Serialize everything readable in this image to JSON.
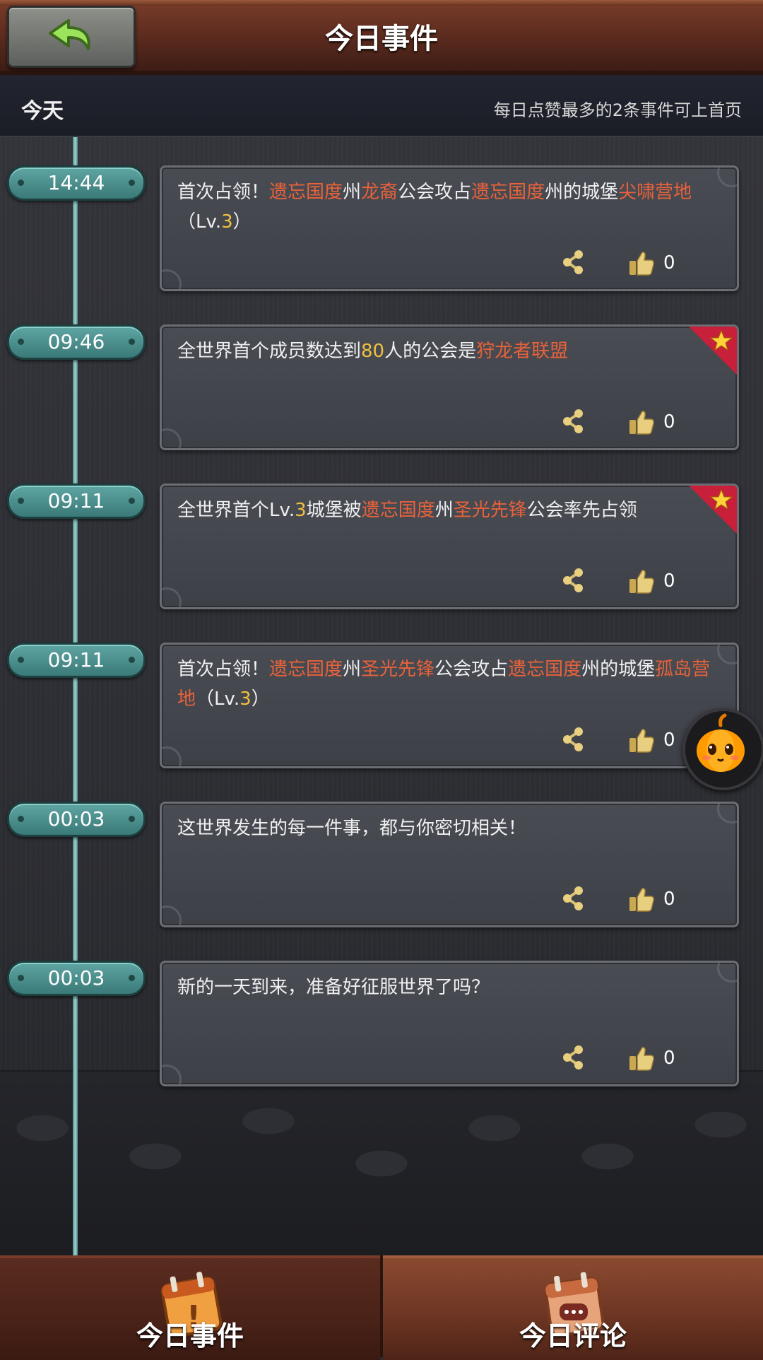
{
  "header": {
    "title": "今日事件"
  },
  "subheader": {
    "day": "今天",
    "hint": "每日点赞最多的2条事件可上首页"
  },
  "events": [
    {
      "time": "14:44",
      "likes": "0",
      "featured": false,
      "segments": [
        {
          "t": "首次占领！"
        },
        {
          "t": "遗忘国度",
          "hl": true
        },
        {
          "t": "州"
        },
        {
          "t": "龙裔",
          "hl": true
        },
        {
          "t": "公会攻占"
        },
        {
          "t": "遗忘国度",
          "hl": true
        },
        {
          "t": "州的城堡"
        },
        {
          "t": "尖啸营地",
          "hl": true
        },
        {
          "t": "（Lv."
        },
        {
          "t": "3",
          "num": true
        },
        {
          "t": "）"
        }
      ]
    },
    {
      "time": "09:46",
      "likes": "0",
      "featured": true,
      "segments": [
        {
          "t": "全世界首个成员数达到"
        },
        {
          "t": "80",
          "num": true
        },
        {
          "t": "人的公会是"
        },
        {
          "t": "狩龙者联盟",
          "hl": true
        }
      ]
    },
    {
      "time": "09:11",
      "likes": "0",
      "featured": true,
      "segments": [
        {
          "t": "全世界首个Lv."
        },
        {
          "t": "3",
          "num": true
        },
        {
          "t": "城堡被"
        },
        {
          "t": "遗忘国度",
          "hl": true
        },
        {
          "t": "州"
        },
        {
          "t": "圣光先锋",
          "hl": true
        },
        {
          "t": "公会率先占领"
        }
      ]
    },
    {
      "time": "09:11",
      "likes": "0",
      "featured": false,
      "segments": [
        {
          "t": "首次占领！"
        },
        {
          "t": "遗忘国度",
          "hl": true
        },
        {
          "t": "州"
        },
        {
          "t": "圣光先锋",
          "hl": true
        },
        {
          "t": "公会攻占"
        },
        {
          "t": "遗忘国度",
          "hl": true
        },
        {
          "t": "州的城堡"
        },
        {
          "t": "孤岛营地",
          "hl": true
        },
        {
          "t": "（Lv."
        },
        {
          "t": "3",
          "num": true
        },
        {
          "t": "）"
        }
      ]
    },
    {
      "time": "00:03",
      "likes": "0",
      "featured": false,
      "segments": [
        {
          "t": "这世界发生的每一件事，都与你密切相关！"
        }
      ]
    },
    {
      "time": "00:03",
      "likes": "0",
      "featured": false,
      "segments": [
        {
          "t": "新的一天到来，准备好征服世界了吗？"
        }
      ]
    }
  ],
  "tabs": [
    {
      "label": "今日事件",
      "icon": "calendar-exclamation-icon",
      "active": true
    },
    {
      "label": "今日评论",
      "icon": "calendar-chat-icon",
      "active": false
    }
  ],
  "colors": {
    "highlight": "#e8623a",
    "number": "#f0c040",
    "timeline": "#7fbcb8"
  }
}
